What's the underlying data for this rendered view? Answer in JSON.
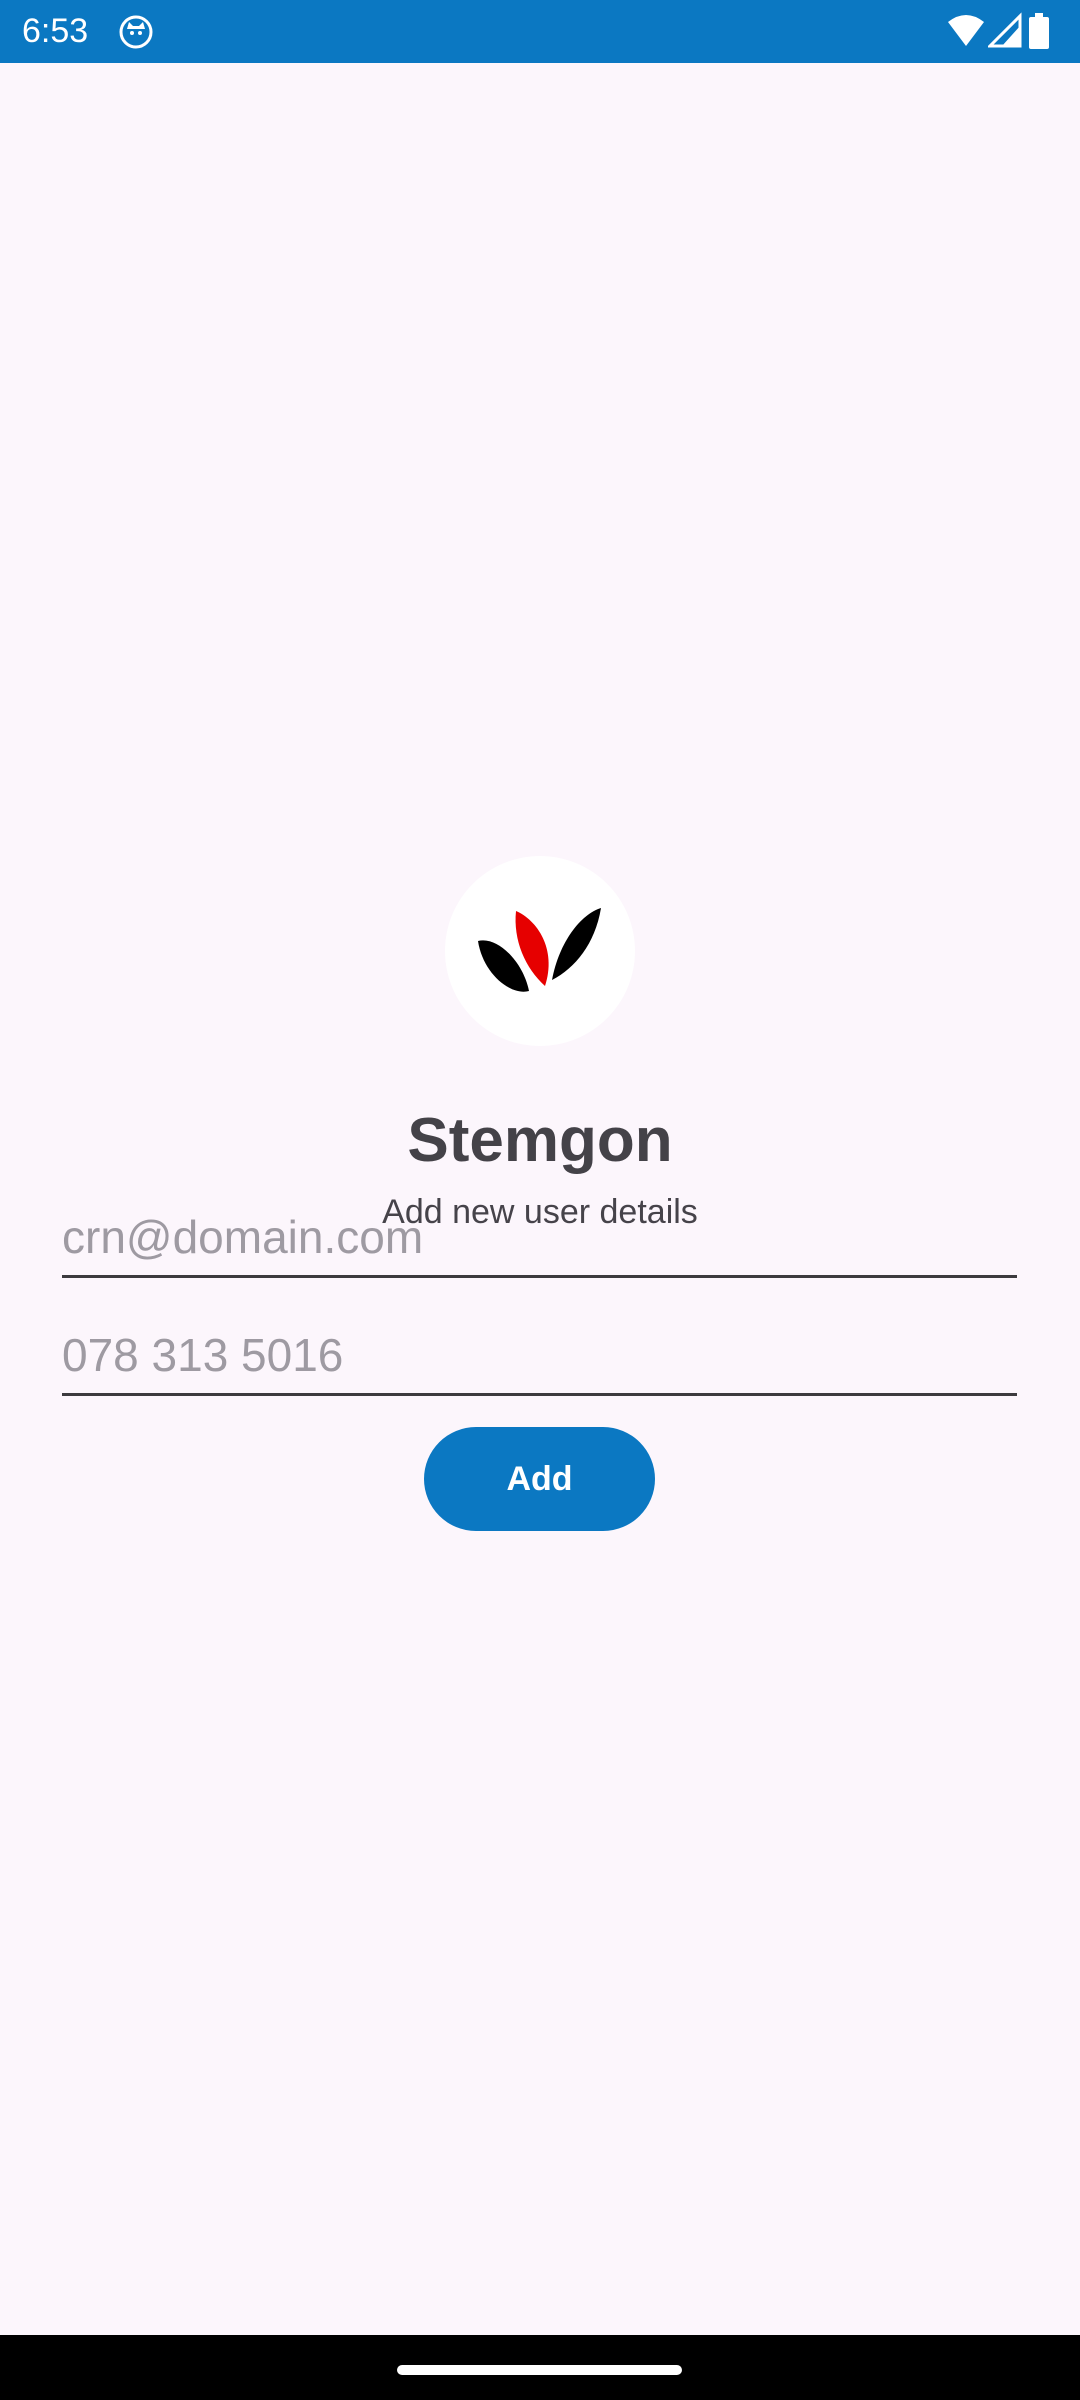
{
  "status_bar": {
    "time": "6:53",
    "app_icon": "cat-face-icon",
    "icons": [
      "wifi-icon",
      "signal-icon",
      "battery-icon"
    ],
    "background": "#0B78C2"
  },
  "app": {
    "name": "Stemgon",
    "subtitle": "Add new user details",
    "logo_icon": "leaf-logo-icon"
  },
  "form": {
    "email": {
      "value": "",
      "placeholder": "crn@domain.com"
    },
    "phone": {
      "value": "",
      "placeholder": "078 313 5016"
    },
    "add_label": "Add"
  },
  "colors": {
    "accent": "#0B78C2",
    "background": "#FCF6FC",
    "logo_red": "#E60000"
  }
}
